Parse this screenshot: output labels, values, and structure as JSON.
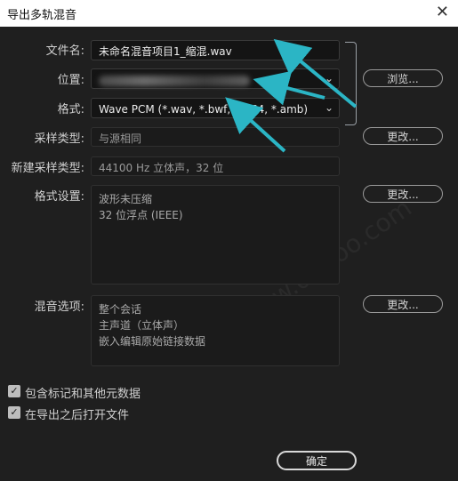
{
  "window": {
    "title": "导出多轨混音",
    "close_glyph": "✕"
  },
  "form": {
    "filename_label": "文件名:",
    "filename_value": "未命名混音项目1_缩混.wav",
    "location_label": "位置:",
    "location_caret": "⌄",
    "browse_button": "浏览...",
    "format_label": "格式:",
    "format_value": "Wave PCM (*.wav, *.bwf, *.rf64, *.amb)",
    "format_caret": "⌄",
    "sample_type_label": "采样类型:",
    "sample_type_value": "与源相同",
    "sample_type_change": "更改...",
    "new_sample_type_label": "新建采样类型:",
    "new_sample_type_value": "44100 Hz 立体声，32 位",
    "format_settings_label": "格式设置:",
    "format_settings_lines": [
      "波形未压缩",
      "32 位浮点 (IEEE)"
    ],
    "format_settings_change": "更改...",
    "mix_options_label": "混音选项:",
    "mix_options_lines": [
      "整个会话",
      "主声道（立体声）",
      "嵌入编辑原始链接数据"
    ],
    "mix_options_change": "更改..."
  },
  "checkboxes": [
    {
      "label": "包含标记和其他元数据",
      "checked": true,
      "mark": "✓"
    },
    {
      "label": "在导出之后打开文件",
      "checked": true,
      "mark": "✓"
    }
  ],
  "ok_button": "确定",
  "colors": {
    "annotation_arrow": "#2bb5c5",
    "background": "#1f1f1f",
    "titlebar": "#ffffff"
  }
}
